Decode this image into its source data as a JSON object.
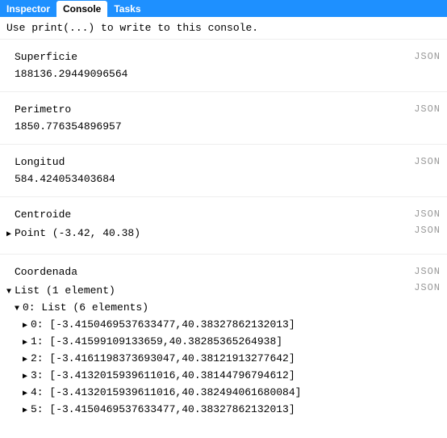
{
  "tabs": {
    "inspector": "Inspector",
    "console": "Console",
    "tasks": "Tasks"
  },
  "hint": "Use print(...) to write to this console.",
  "json_label": "JSON",
  "entries": {
    "superficie": {
      "label": "Superficie",
      "value": "188136.29449096564"
    },
    "perimetro": {
      "label": "Perimetro",
      "value": "1850.776354896957"
    },
    "longitud": {
      "label": "Longitud",
      "value": "584.424053403684"
    },
    "centroide": {
      "label": "Centroide",
      "value": "Point (-3.42, 40.38)"
    },
    "coordenada": {
      "label": "Coordenada",
      "list_header": "List (1 element)",
      "item0_header": "0: List (6 elements)",
      "coords": [
        {
          "idx": "0:",
          "val": "[-3.4150469537633477,40.38327862132013]"
        },
        {
          "idx": "1:",
          "val": "[-3.41599109133659,40.38285365264938]"
        },
        {
          "idx": "2:",
          "val": "[-3.4161198373693047,40.38121913277642]"
        },
        {
          "idx": "3:",
          "val": "[-3.4132015939611016,40.38144796794612]"
        },
        {
          "idx": "4:",
          "val": "[-3.4132015939611016,40.382494061680084]"
        },
        {
          "idx": "5:",
          "val": "[-3.4150469537633477,40.38327862132013]"
        }
      ]
    }
  }
}
